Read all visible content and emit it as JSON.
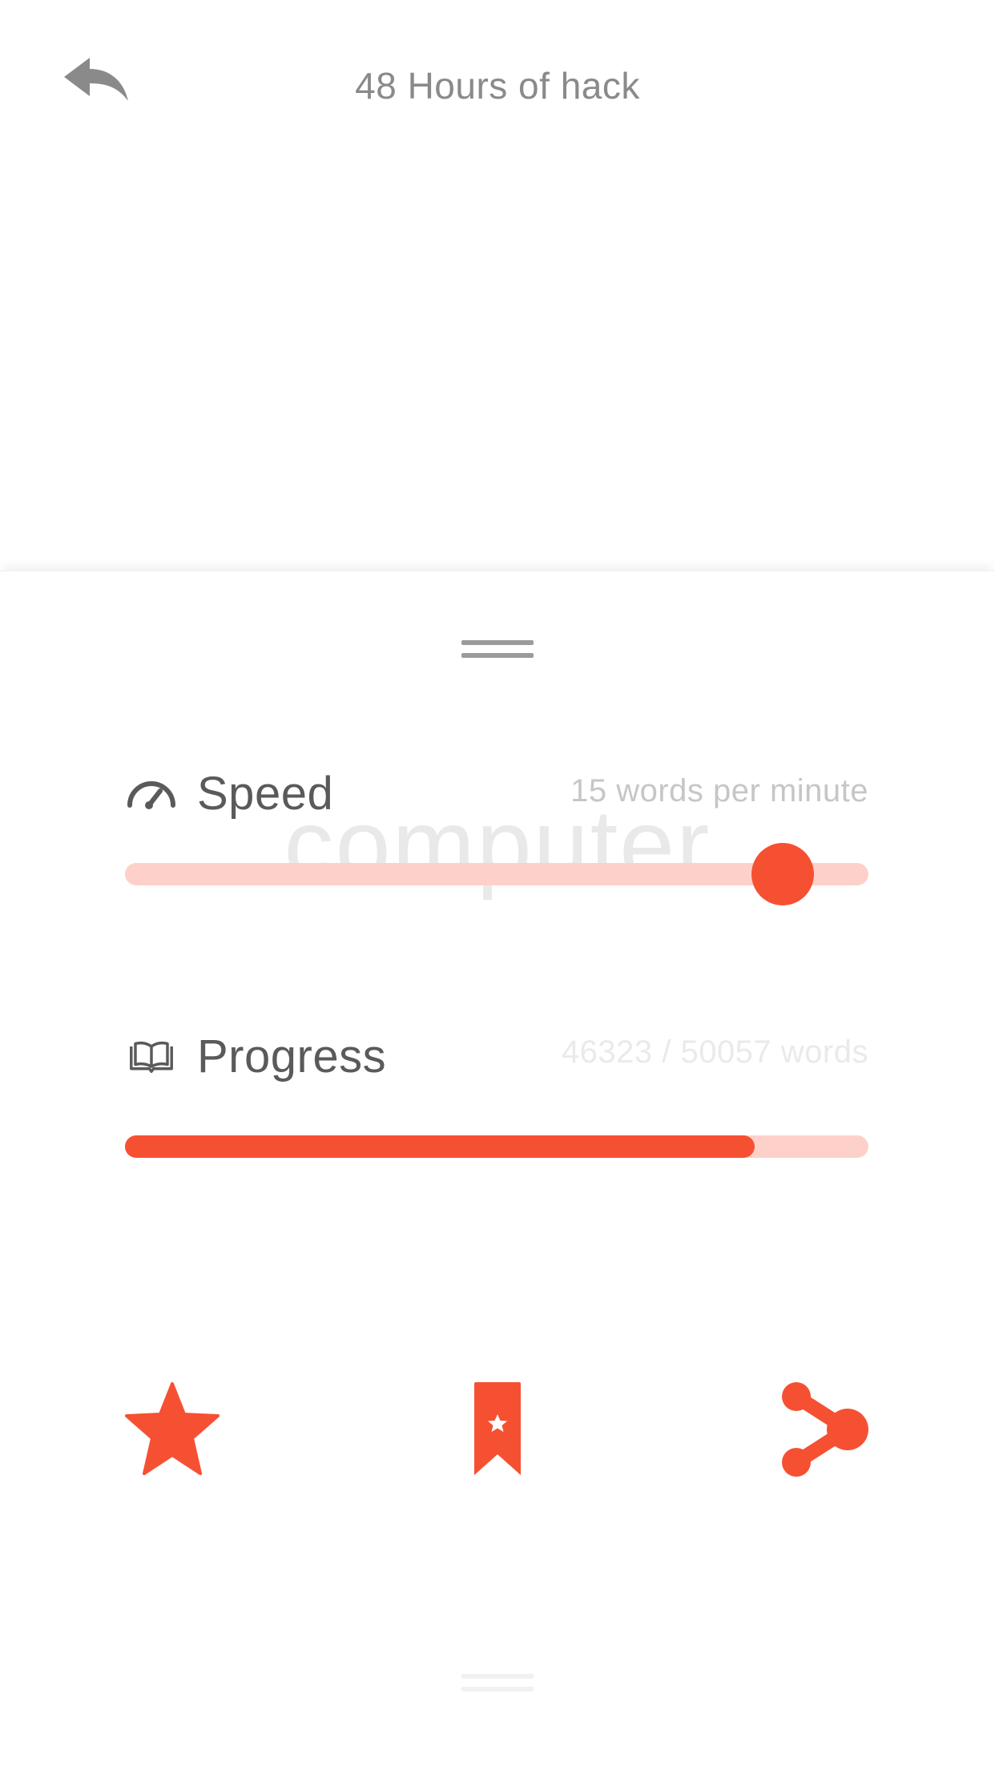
{
  "header": {
    "title": "48 Hours of hack",
    "back_icon": "reply-arrow-icon"
  },
  "colors": {
    "accent": "#f65033",
    "accent_light": "#fdd1c9",
    "icon_gray": "#8a8a8a",
    "label_gray": "#5a5a5a"
  },
  "reader": {
    "current_word": "computer"
  },
  "speed": {
    "label": "Speed",
    "icon": "speedometer-icon",
    "value_text": "15 words per minute",
    "slider_level": 0.885
  },
  "progress": {
    "label": "Progress",
    "icon": "open-book-icon",
    "value_text": "46323 / 50057 words",
    "current": 46323,
    "total": 50057
  },
  "actions": [
    {
      "name": "favorite",
      "icon": "star-icon"
    },
    {
      "name": "bookmark",
      "icon": "bookmark-icon"
    },
    {
      "name": "share",
      "icon": "share-icon"
    }
  ]
}
